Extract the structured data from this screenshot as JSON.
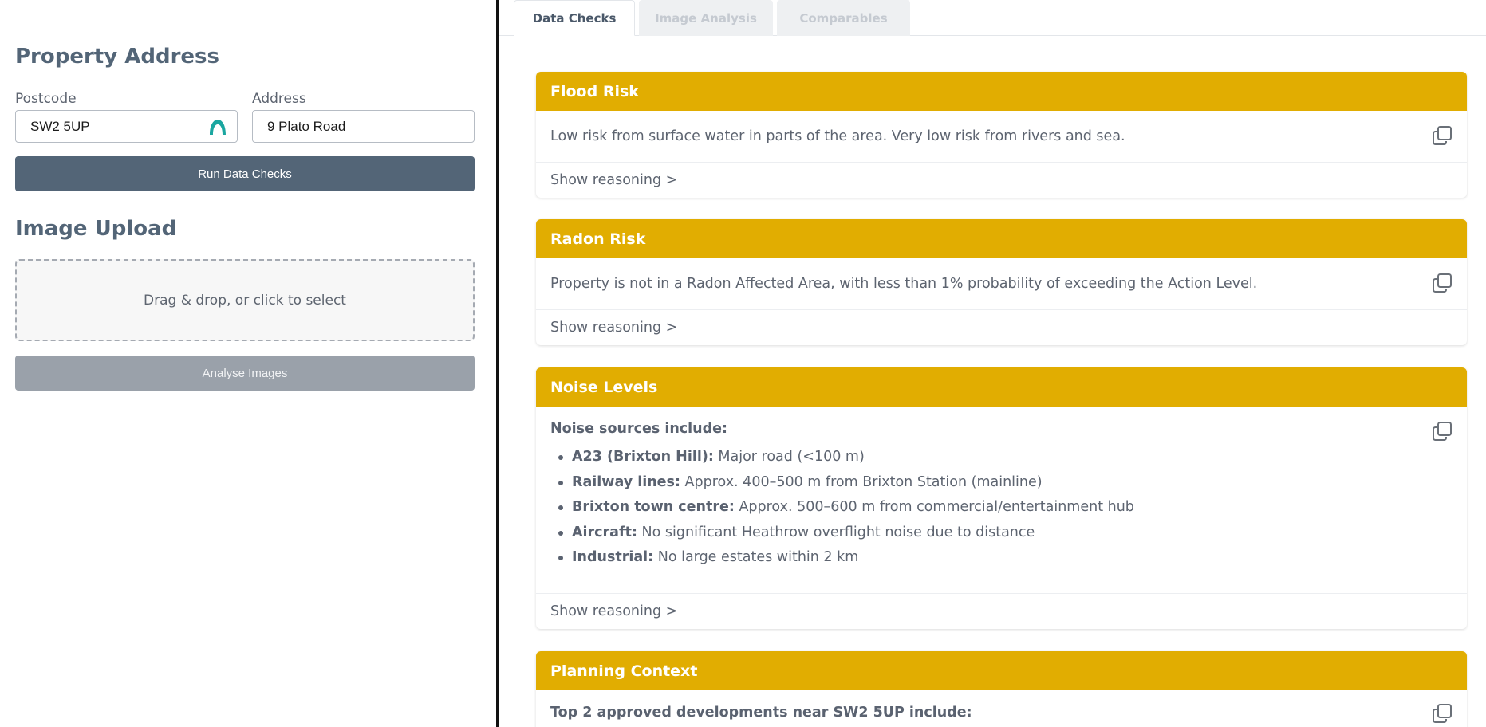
{
  "left": {
    "property_heading": "Property Address",
    "postcode_label": "Postcode",
    "postcode_value": "SW2 5UP",
    "address_label": "Address",
    "address_value": "9 Plato Road",
    "run_button": "Run Data Checks",
    "image_heading": "Image Upload",
    "dropzone_text": "Drag & drop, or click to select",
    "analyse_button": "Analyse Images"
  },
  "tabs": [
    {
      "label": "Data Checks",
      "active": true
    },
    {
      "label": "Image Analysis",
      "active": false
    },
    {
      "label": "Comparables",
      "active": false
    }
  ],
  "cards": {
    "flood": {
      "title": "Flood Risk",
      "text": "Low risk from surface water in parts of the area. Very low risk from rivers and sea.",
      "footer": "Show reasoning >"
    },
    "radon": {
      "title": "Radon Risk",
      "text": "Property is not in a Radon Affected Area, with less than 1% probability of exceeding the Action Level.",
      "footer": "Show reasoning >"
    },
    "noise": {
      "title": "Noise Levels",
      "intro": "Noise sources include:",
      "items": [
        {
          "label": "A23 (Brixton Hill):",
          "text": " Major road (<100 m)"
        },
        {
          "label": "Railway lines:",
          "text": " Approx. 400–500 m from Brixton Station (mainline)"
        },
        {
          "label": "Brixton town centre:",
          "text": " Approx. 500–600 m from commercial/entertainment hub"
        },
        {
          "label": "Aircraft:",
          "text": " No significant Heathrow overflight noise due to distance"
        },
        {
          "label": "Industrial:",
          "text": " No large estates within 2 km"
        }
      ],
      "footer": "Show reasoning >"
    },
    "planning": {
      "title": "Planning Context",
      "intro": "Top 2 approved developments near SW2 5UP include:"
    }
  },
  "colors": {
    "accent": "#e1ad01",
    "primary_button": "#536577",
    "disabled_button": "#9aa1aa",
    "postcode_icon": "#1aa6a0"
  },
  "icons": {
    "postcode_field": "teal-arch-icon",
    "card_action": "copy-icon"
  }
}
